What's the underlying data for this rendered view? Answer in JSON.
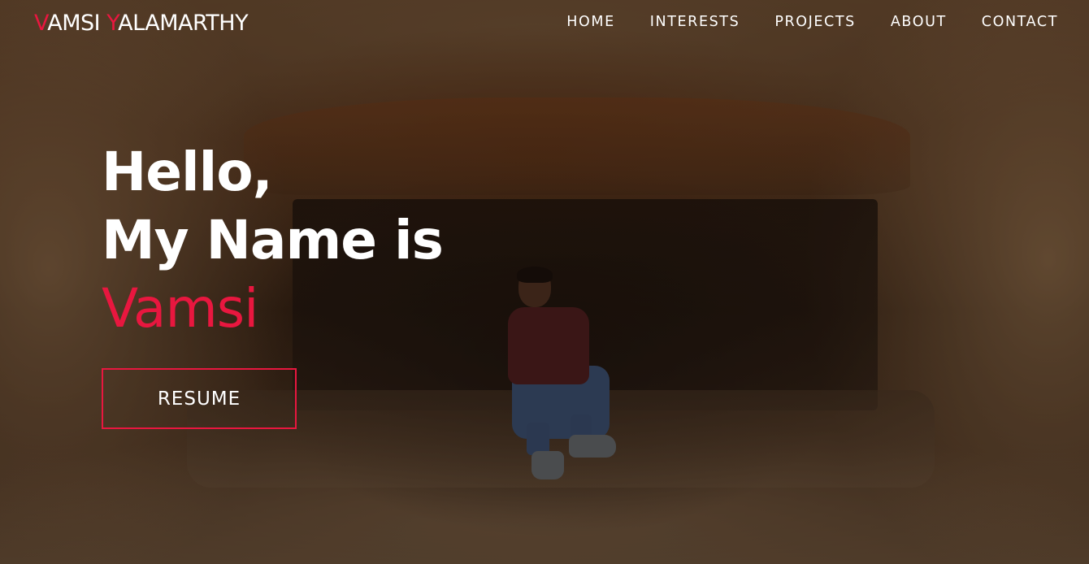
{
  "brand": {
    "first_initial": "V",
    "first_rest": "AMSI ",
    "last_initial": "Y",
    "last_rest": "ALAMARTHY",
    "accent_color": "#e8173f"
  },
  "nav": {
    "items": [
      {
        "label": "HOME"
      },
      {
        "label": "INTERESTS"
      },
      {
        "label": "PROJECTS"
      },
      {
        "label": "ABOUT"
      },
      {
        "label": "CONTACT"
      }
    ]
  },
  "hero": {
    "line1": "Hello,",
    "line2": "My Name is",
    "name": "Vamsi",
    "resume_label": "RESUME",
    "background": "cave-photo"
  }
}
